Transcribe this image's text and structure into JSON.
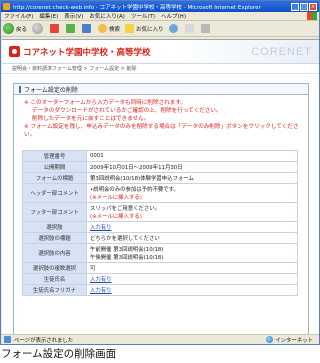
{
  "window": {
    "title": "http://corenet.check-web.info - コアネット学園中学校・高等学校 - Microsoft Internet Explorer"
  },
  "menu": [
    "ファイル(F)",
    "編集(E)",
    "表示(V)",
    "お気に入り(A)",
    "ツール(T)",
    "ヘルプ(H)"
  ],
  "toolbar": {
    "back_label": "戻る",
    "search_label": "検索",
    "favorites_label": "お気に入り"
  },
  "site": {
    "name": "コアネット学園中学校・高等学校",
    "brand": "CORENET"
  },
  "breadcrumb": "説明会・資料請求フォーム管理 > フォーム設定 > 削除",
  "panel": {
    "title": "フォーム設定の削除",
    "warnings": [
      "※ このオーダーフォームから入力データも同時に削除されます。",
      "データのダウンロードがされているかご確認の上、削除を行ってください。",
      "削除したデータを元に戻すことはできません。",
      "※ フォーム設定を残し、申込みデータのみを削除する場合は「データのみ削除」ボタンをクリックしてください。"
    ]
  },
  "table": {
    "rows": [
      {
        "label": "管理番号",
        "value": "0001"
      },
      {
        "label": "公開期間",
        "value": "2009年10月01日～2009年11月30日"
      },
      {
        "label": "フォームの標題",
        "value": "第3回説明会(10/18)体験学習申込フォーム"
      },
      {
        "label": "ヘッダー部コメント",
        "value": "•説明会のみの参加は予約不要です。",
        "value2": "(※メールに挿入する)"
      },
      {
        "label": "フッター部コメント",
        "value": "スリッパをご用意ください。",
        "value2": "(※メールに挿入する)"
      },
      {
        "label": "選択肢",
        "value": "入力有り"
      },
      {
        "label": "選択肢の標題",
        "value": "どちらかを選択してください"
      },
      {
        "label": "選択肢の内容",
        "value": "午前開催 第3回説明会(10/18)",
        "value2": "午後開催 第3回説明会(10/18)"
      },
      {
        "label": "選択肢の複数選択",
        "value": "可"
      },
      {
        "label": "生徒氏名",
        "value": "入力有り"
      },
      {
        "label": "生徒氏名フリガナ",
        "value": "入力有り"
      }
    ]
  },
  "status": {
    "left": "ページが表示されました",
    "zone": "インターネット"
  },
  "caption": "フォーム設定の削除画面"
}
